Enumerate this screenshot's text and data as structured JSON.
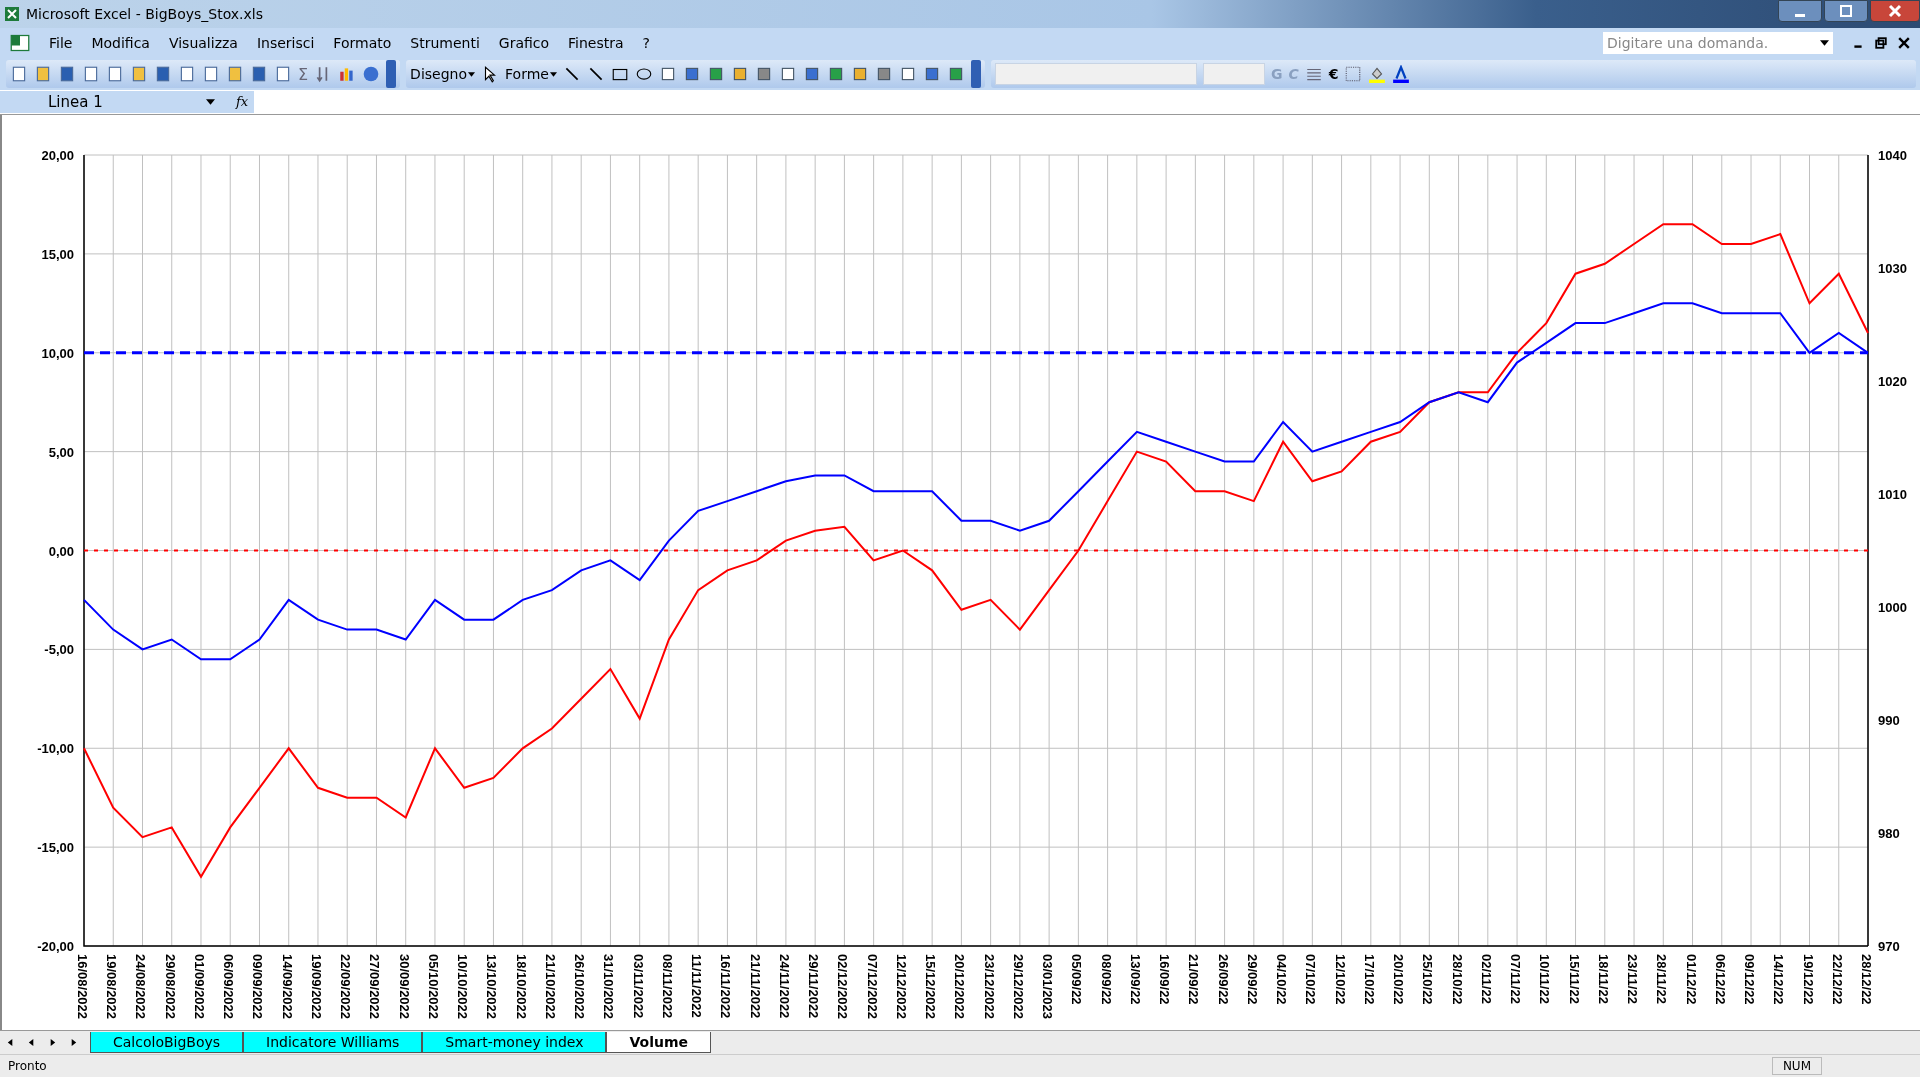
{
  "window": {
    "title": "Microsoft Excel - BigBoys_Stox.xls"
  },
  "menu": [
    "File",
    "Modifica",
    "Visualizza",
    "Inserisci",
    "Formato",
    "Strumenti",
    "Grafico",
    "Finestra",
    "?"
  ],
  "help_search": {
    "placeholder": "Digitare una domanda."
  },
  "toolbar": {
    "sum": "Σ",
    "drawing_menu": "Disegno",
    "shapes_menu": "Forme",
    "bold": "G",
    "italic": "C",
    "euro": "€"
  },
  "name_box": {
    "value": "Linea 1"
  },
  "formula_label": "fx",
  "chart": {
    "chart_data": {
      "type": "line",
      "categories": [
        "16/08/2022",
        "19/08/2022",
        "24/08/2022",
        "29/08/2022",
        "01/09/2022",
        "06/09/2022",
        "09/09/2022",
        "14/09/2022",
        "19/09/2022",
        "22/09/2022",
        "27/09/2022",
        "30/09/2022",
        "05/10/2022",
        "10/10/2022",
        "13/10/2022",
        "18/10/2022",
        "21/10/2022",
        "26/10/2022",
        "31/10/2022",
        "03/11/2022",
        "08/11/2022",
        "11/11/2022",
        "16/11/2022",
        "21/11/2022",
        "24/11/2022",
        "29/11/2022",
        "02/12/2022",
        "07/12/2022",
        "12/12/2022",
        "15/12/2022",
        "20/12/2022",
        "23/12/2022",
        "29/12/2022",
        "03/01/2023",
        "05/09/22",
        "08/09/22",
        "13/09/22",
        "16/09/22",
        "21/09/22",
        "26/09/22",
        "29/09/22",
        "04/10/22",
        "07/10/22",
        "12/10/22",
        "17/10/22",
        "20/10/22",
        "25/10/22",
        "28/10/22",
        "02/11/22",
        "07/11/22",
        "10/11/22",
        "15/11/22",
        "18/11/22",
        "23/11/22",
        "28/11/22",
        "01/12/22",
        "06/12/22",
        "09/12/22",
        "14/12/22",
        "19/12/22",
        "22/12/22",
        "28/12/22"
      ],
      "series": [
        {
          "color": "#ff0000",
          "values": [
            -10,
            -13,
            -14.5,
            -14,
            -16.5,
            -14,
            -12,
            -10,
            -12,
            -12.5,
            -12.5,
            -13.5,
            -10,
            -12,
            -11.5,
            -10,
            -9,
            -7.5,
            -6,
            -8.5,
            -4.5,
            -2,
            -1,
            -0.5,
            0.5,
            1,
            1.2,
            -0.5,
            0,
            -1,
            -3,
            -2.5,
            -4,
            -2,
            0,
            2.5,
            5,
            4.5,
            3,
            3,
            2.5,
            5.5,
            3.5,
            4,
            5.5,
            6,
            7.5,
            8,
            8,
            10,
            11.5,
            14,
            14.5,
            15.5,
            16.5,
            16.5,
            15.5,
            15.5,
            16,
            12.5,
            14,
            11
          ]
        },
        {
          "color": "#0000ff",
          "values": [
            -2.5,
            -4,
            -5,
            -4.5,
            -5.5,
            -5.5,
            -4.5,
            -2.5,
            -3.5,
            -4,
            -4,
            -4.5,
            -2.5,
            -3.5,
            -3.5,
            -2.5,
            -2,
            -1,
            -0.5,
            -1.5,
            0.5,
            2,
            2.5,
            3,
            3.5,
            3.8,
            3.8,
            3,
            3,
            3,
            1.5,
            1.5,
            1,
            1.5,
            3,
            4.5,
            6,
            5.5,
            5,
            4.5,
            4.5,
            6.5,
            5,
            5.5,
            6,
            6.5,
            7.5,
            8,
            7.5,
            9.5,
            10.5,
            11.5,
            11.5,
            12,
            12.5,
            12.5,
            12,
            12,
            12,
            10,
            11,
            10
          ]
        },
        {
          "color": "#0000ff",
          "line_style": "dashed",
          "values": [
            10,
            10,
            10,
            10,
            10,
            10,
            10,
            10,
            10,
            10,
            10,
            10,
            10,
            10,
            10,
            10,
            10,
            10,
            10,
            10,
            10,
            10,
            10,
            10,
            10,
            10,
            10,
            10,
            10,
            10,
            10,
            10,
            10,
            10,
            10,
            10,
            10,
            10,
            10,
            10,
            10,
            10,
            10,
            10,
            10,
            10,
            10,
            10,
            10,
            10,
            10,
            10,
            10,
            10,
            10,
            10,
            10,
            10,
            10,
            10,
            10,
            10
          ]
        },
        {
          "color": "#ff0000",
          "line_style": "dotted",
          "values": [
            0,
            0,
            0,
            0,
            0,
            0,
            0,
            0,
            0,
            0,
            0,
            0,
            0,
            0,
            0,
            0,
            0,
            0,
            0,
            0,
            0,
            0,
            0,
            0,
            0,
            0,
            0,
            0,
            0,
            0,
            0,
            0,
            0,
            0,
            0,
            0,
            0,
            0,
            0,
            0,
            0,
            0,
            0,
            0,
            0,
            0,
            0,
            0,
            0,
            0,
            0,
            0,
            0,
            0,
            0,
            0,
            0,
            0,
            0,
            0,
            0,
            0
          ]
        }
      ],
      "grid": true,
      "ylim": [
        -20,
        20
      ],
      "yticks": [
        {
          "value": 20,
          "label": "20,00"
        },
        {
          "value": 15,
          "label": "15,00"
        },
        {
          "value": 10,
          "label": "10,00"
        },
        {
          "value": 5,
          "label": "5,00"
        },
        {
          "value": 0,
          "label": "0,00"
        },
        {
          "value": -5,
          "label": "-5,00"
        },
        {
          "value": -10,
          "label": "-10,00"
        },
        {
          "value": -15,
          "label": "-15,00"
        },
        {
          "value": -20,
          "label": "-20,00"
        }
      ]
    },
    "right_axis_ticks": [
      "1040",
      "1030",
      "1020",
      "1010",
      "1000",
      "990",
      "980",
      "970"
    ]
  },
  "sheet_tabs": [
    {
      "label": "CalcoloBigBoys",
      "selected": false
    },
    {
      "label": "Indicatore Williams",
      "selected": false
    },
    {
      "label": "Smart-money index",
      "selected": false
    },
    {
      "label": "Volume",
      "selected": true
    }
  ],
  "status_bar": {
    "text": "Pronto",
    "indicator": "NUM"
  }
}
